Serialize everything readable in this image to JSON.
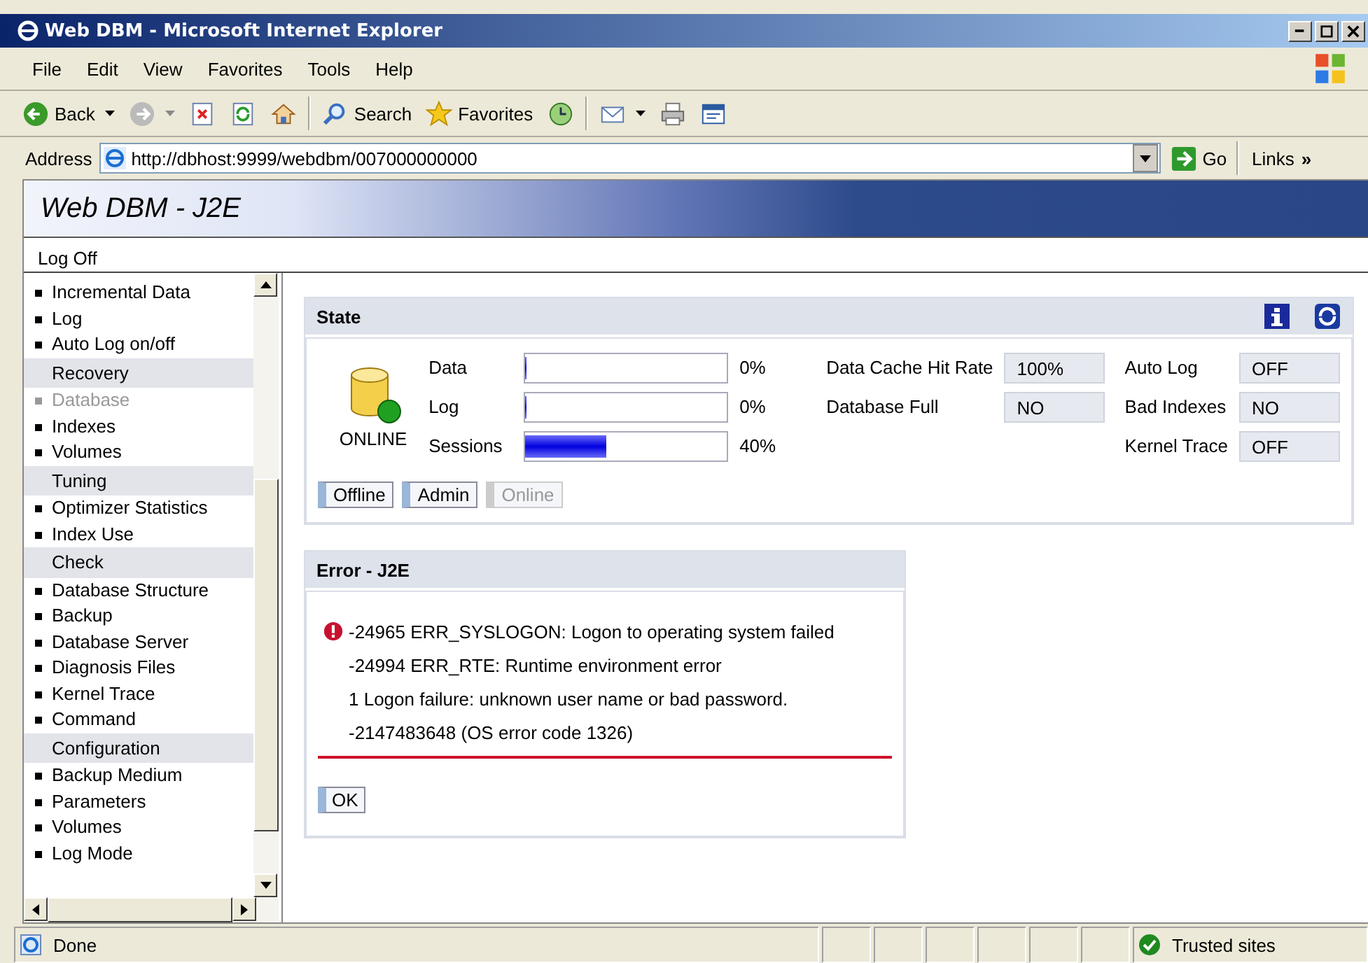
{
  "window": {
    "title": "Web DBM - Microsoft Internet Explorer"
  },
  "menu": [
    "File",
    "Edit",
    "View",
    "Favorites",
    "Tools",
    "Help"
  ],
  "toolbar": [
    {
      "kind": "back",
      "label": "Back"
    },
    {
      "kind": "forward"
    },
    {
      "kind": "stop"
    },
    {
      "kind": "refresh"
    },
    {
      "kind": "home"
    },
    {
      "kind": "search",
      "label": "Search"
    },
    {
      "kind": "favorites",
      "label": "Favorites"
    },
    {
      "kind": "history"
    },
    {
      "kind": "mail"
    },
    {
      "kind": "print"
    },
    {
      "kind": "edit"
    }
  ],
  "address": {
    "label": "Address",
    "value": "http://dbhost:9999/webdbm/007000000000",
    "go": "Go",
    "links": "Links",
    "more": "»"
  },
  "app": {
    "title": "Web DBM - J2E",
    "logoff": "Log Off"
  },
  "sidebar": {
    "items": [
      {
        "kind": "item",
        "label": "Incremental Data",
        "disabled": false
      },
      {
        "kind": "item",
        "label": "Log",
        "disabled": false
      },
      {
        "kind": "item",
        "label": "Auto Log on/off",
        "disabled": false
      },
      {
        "kind": "group",
        "label": "Recovery"
      },
      {
        "kind": "item",
        "label": "Database",
        "disabled": true
      },
      {
        "kind": "item",
        "label": "Indexes",
        "disabled": false
      },
      {
        "kind": "item",
        "label": "Volumes",
        "disabled": false
      },
      {
        "kind": "group",
        "label": "Tuning"
      },
      {
        "kind": "item",
        "label": "Optimizer Statistics",
        "disabled": false
      },
      {
        "kind": "item",
        "label": "Index Use",
        "disabled": false
      },
      {
        "kind": "group",
        "label": "Check"
      },
      {
        "kind": "item",
        "label": "Database Structure",
        "disabled": false
      },
      {
        "kind": "item",
        "label": "Backup",
        "disabled": false
      },
      {
        "kind": "item",
        "label": "Database Server",
        "disabled": false
      },
      {
        "kind": "item",
        "label": "Diagnosis Files",
        "disabled": false
      },
      {
        "kind": "item",
        "label": "Kernel Trace",
        "disabled": false
      },
      {
        "kind": "item",
        "label": "Command",
        "disabled": false
      },
      {
        "kind": "group",
        "label": "Configuration"
      },
      {
        "kind": "item",
        "label": "Backup Medium",
        "disabled": false
      },
      {
        "kind": "item",
        "label": "Parameters",
        "disabled": false
      },
      {
        "kind": "item",
        "label": "Volumes",
        "disabled": false
      },
      {
        "kind": "item",
        "label": "Log Mode",
        "disabled": false
      }
    ]
  },
  "state": {
    "title": "State",
    "status": "ONLINE",
    "meters": [
      {
        "label": "Data",
        "level": 0,
        "reading": "0%"
      },
      {
        "label": "Log",
        "level": 0,
        "reading": "0%"
      },
      {
        "label": "Sessions",
        "level": 0.4,
        "reading": "40%"
      }
    ],
    "middle": [
      {
        "label": "Data Cache Hit Rate",
        "value": "100%"
      },
      {
        "label": "Database Full",
        "value": "NO"
      }
    ],
    "right": [
      {
        "label": "Auto Log",
        "value": "OFF"
      },
      {
        "label": "Bad Indexes",
        "value": "NO"
      },
      {
        "label": "Kernel Trace",
        "value": "OFF"
      }
    ],
    "buttons": [
      {
        "label": "Offline",
        "disabled": false
      },
      {
        "label": "Admin",
        "disabled": false
      },
      {
        "label": "Online",
        "disabled": true
      }
    ]
  },
  "error": {
    "title": "Error - J2E",
    "lines": [
      "-24965 ERR_SYSLOGON: Logon to operating system failed",
      "-24994 ERR_RTE: Runtime environment error",
      "1 Logon failure: unknown user name or bad password.",
      "-2147483648 (OS error code 1326)"
    ],
    "button": "OK"
  },
  "status_bar": {
    "text": "Done",
    "zone": "Trusted sites"
  }
}
